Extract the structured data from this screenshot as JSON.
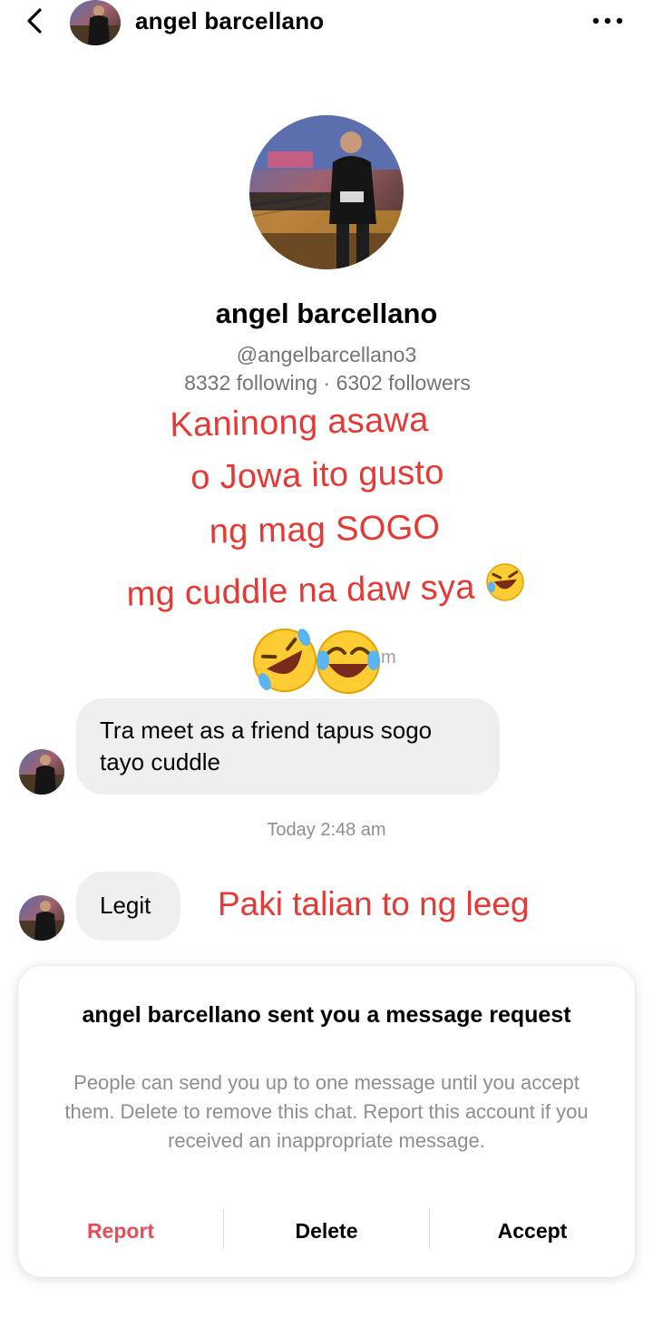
{
  "header": {
    "back_icon": "chevron-left-icon",
    "name": "angel barcellano",
    "more_icon": "more-horizontal-icon"
  },
  "profile": {
    "name": "angel barcellano",
    "handle": "@angelbarcellano3",
    "stats": "8332 following · 6302 followers"
  },
  "overlay": {
    "lines": [
      "Kaninong asawa",
      "o Jowa ito gusto",
      "ng mag SOGO",
      "mg cuddle na daw sya"
    ],
    "emoji_line": "🤣😂",
    "tail": "m"
  },
  "messages": [
    {
      "text": "Tra meet as a friend tapus sogo tayo cuddle"
    },
    {
      "text": "Legit"
    }
  ],
  "timestamp": "Today 2:48 am",
  "side_text": "Paki talian to ng leeg",
  "request_sheet": {
    "title": "angel barcellano sent you a message request",
    "description": "People can send you up to one message until you accept them. Delete to remove this chat. Report this account if you received an inappropriate message.",
    "actions": {
      "report": "Report",
      "delete": "Delete",
      "accept": "Accept"
    }
  },
  "colors": {
    "report": "#ed4956",
    "overlay_text": "#e53935",
    "bubble_bg": "#efefef",
    "secondary_text": "#737373"
  }
}
